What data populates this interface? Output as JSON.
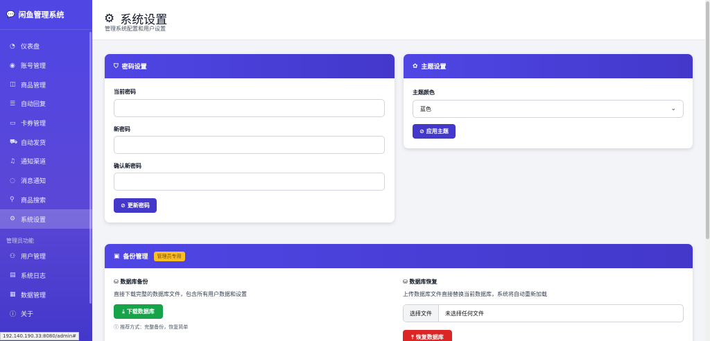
{
  "brand": {
    "icon": "chat-bubble-icon",
    "name": "闲鱼管理系统"
  },
  "nav": [
    {
      "label": "仪表盘",
      "icon": "dashboard-icon"
    },
    {
      "label": "账号管理",
      "icon": "user-circle-icon"
    },
    {
      "label": "商品管理",
      "icon": "box-icon"
    },
    {
      "label": "自动回复",
      "icon": "reply-icon"
    },
    {
      "label": "卡券管理",
      "icon": "card-icon"
    },
    {
      "label": "自动发货",
      "icon": "truck-icon"
    },
    {
      "label": "通知渠道",
      "icon": "bell-icon"
    },
    {
      "label": "消息通知",
      "icon": "message-icon"
    },
    {
      "label": "商品搜索",
      "icon": "search-icon"
    },
    {
      "label": "系统设置",
      "icon": "gear-icon",
      "active": true
    }
  ],
  "admin_section": {
    "label": "管理员功能",
    "items": [
      {
        "label": "用户管理",
        "icon": "users-icon"
      },
      {
        "label": "系统日志",
        "icon": "file-icon"
      },
      {
        "label": "数据管理",
        "icon": "database-icon"
      },
      {
        "label": "关于",
        "icon": "info-icon"
      }
    ]
  },
  "status_url": "192.140.190.33:8080/admin#",
  "header": {
    "title": "系统设置",
    "subtitle": "管理系统配置和用户设置"
  },
  "password_card": {
    "title": "密码设置",
    "current_label": "当前密码",
    "new_label": "新密码",
    "confirm_label": "确认新密码",
    "current_value": "",
    "new_value": "",
    "confirm_value": "",
    "button": "更新密码"
  },
  "theme_card": {
    "title": "主题设置",
    "color_label": "主题颜色",
    "selected": "蓝色",
    "button": "应用主题"
  },
  "backup_card": {
    "title": "备份管理",
    "badge": "管理员专用",
    "backup_title": "数据库备份",
    "backup_desc": "直接下载完整的数据库文件，包含所有用户数据和设置",
    "download_button": "下载数据库",
    "tip": "推荐方式：完整备份，恢复简单",
    "restore_title": "数据库恢复",
    "restore_desc": "上传数据库文件直接替换当前数据库，系统将自动重新加载",
    "choose_file": "选择文件",
    "no_file": "未选择任何文件",
    "restore_button": "恢复数据库"
  },
  "colors": {
    "sidebar": "#4f46e5",
    "primary": "#4338ca",
    "success": "#16a34a",
    "danger": "#dc2626",
    "badge": "#fbbf24"
  }
}
